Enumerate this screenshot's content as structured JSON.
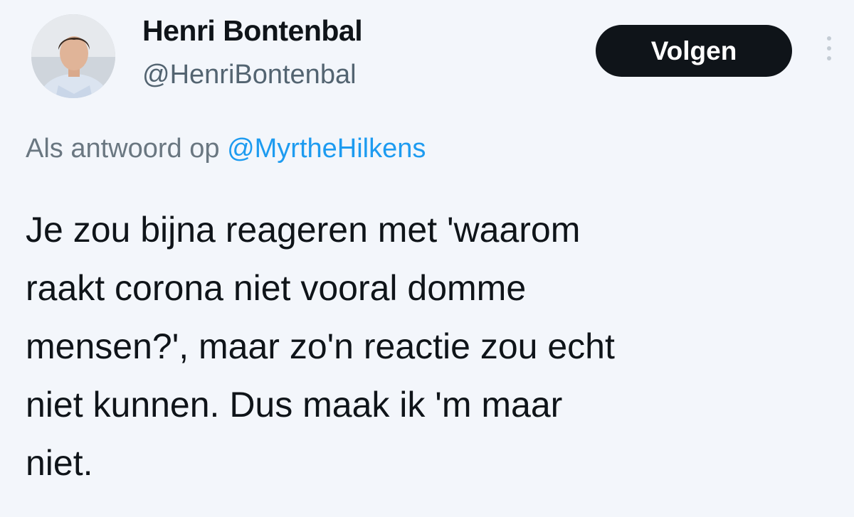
{
  "author": {
    "display_name": "Henri Bontenbal",
    "handle": "@HenriBontenbal",
    "avatar_icon": "profile-photo"
  },
  "actions": {
    "follow_label": "Volgen",
    "more_icon": "more-options-icon"
  },
  "reply": {
    "prefix": "Als antwoord op",
    "mention": "@MyrtheHilkens"
  },
  "tweet": {
    "lines": [
      "Je zou bijna reageren met 'waarom",
      "raakt corona niet vooral domme",
      "mensen?', maar zo'n reactie zou echt",
      "niet kunnen. Dus maak ik 'm maar",
      "niet."
    ]
  },
  "colors": {
    "background": "#f3f6fb",
    "text": "#0f1419",
    "secondary_text": "#536471",
    "link": "#1d9bf0",
    "button_bg": "#0f1419"
  }
}
